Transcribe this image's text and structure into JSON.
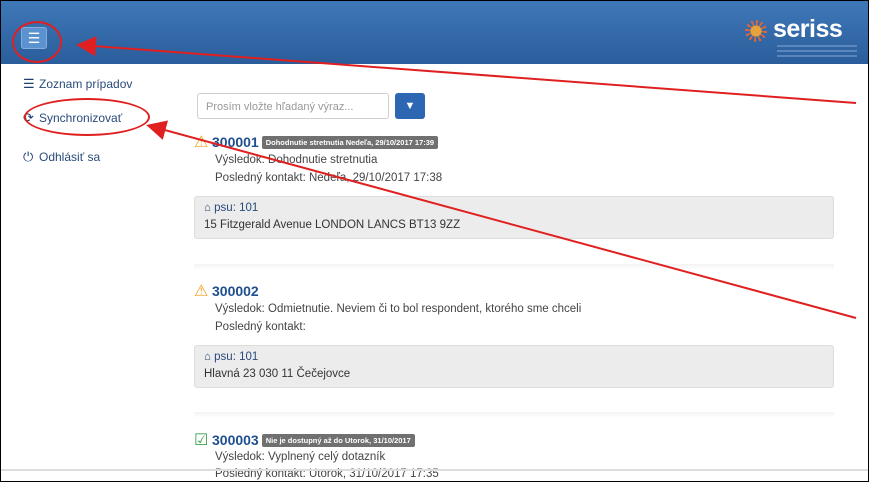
{
  "header": {
    "menu_icon": "hamburger-icon",
    "logo_text": "seriss"
  },
  "sidebar": {
    "items": [
      {
        "icon": "list-icon",
        "label": "Zoznam prípadov"
      },
      {
        "icon": "sync-icon",
        "label": "Synchronizovať"
      },
      {
        "icon": "power-icon",
        "label": "Odhlásiť sa"
      }
    ]
  },
  "search": {
    "placeholder": "Prosím vložte hľadaný výraz...",
    "filter_icon": "filter-icon"
  },
  "cases": [
    {
      "status_icon": "warning-icon",
      "id": "300001",
      "badge": "Dohodnutie stretnutia Nedeľa, 29/10/2017 17:39",
      "result": "Výsledok: Dohodnutie stretnutia",
      "last_contact": "Posledný kontakt: Nedeľa, 29/10/2017 17:38",
      "psu": "psu: 101",
      "address": "15 Fitzgerald Avenue LONDON LANCS BT13 9ZZ"
    },
    {
      "status_icon": "warning-icon",
      "id": "300002",
      "badge": "",
      "result": "Výsledok: Odmietnutie. Neviem či to bol respondent, ktorého sme chceli",
      "last_contact": "Posledný kontakt:",
      "psu": "psu: 101",
      "address": "Hlavná 23 030 11 Čečejovce"
    },
    {
      "status_icon": "check-icon",
      "id": "300003",
      "badge": "Nie je dostupný až do Utorok, 31/10/2017",
      "result": "Výsledok: Vyplnený celý dotazník",
      "last_contact": "Posledný kontakt: Utorok, 31/10/2017 17:35"
    }
  ],
  "colors": {
    "header": "#2f68a8",
    "accent": "#2d66b3",
    "callout": "#e02020"
  }
}
